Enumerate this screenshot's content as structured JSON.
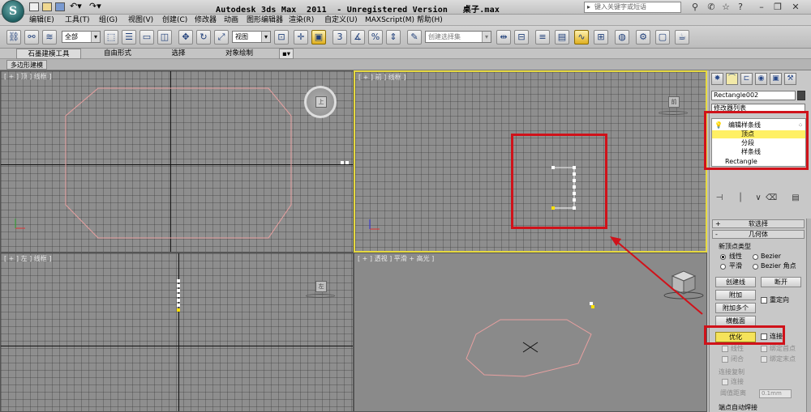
{
  "titlebar": {
    "logo": "S",
    "title": "Autodesk 3ds Max  2011  - Unregistered Version   桌子.max",
    "search_placeholder": "键入关键字或短语"
  },
  "menu": [
    "编辑(E)",
    "工具(T)",
    "组(G)",
    "视图(V)",
    "创建(C)",
    "修改器",
    "动画",
    "图形编辑器",
    "渲染(R)",
    "自定义(U)",
    "MAXScript(M)",
    "帮助(H)"
  ],
  "toolbar": {
    "filter_value": "全部",
    "refcoord_value": "视图",
    "selection_set_placeholder": "创建选择集"
  },
  "ribbon": {
    "tabs": [
      "石墨建模工具",
      "自由形式",
      "选择",
      "对象绘制"
    ],
    "subtab": "多边形建模"
  },
  "viewports": {
    "top": "[ + ] 顶 ] 线框 ]",
    "front": "[ + ] 前 ] 线框 ]",
    "left": "[ + ] 左 ] 线框 ]",
    "persp": "[ + ] 透视 ] 平滑 + 高光 ]",
    "top_cube": "上",
    "front_cube": "前",
    "left_cube": "左"
  },
  "command_panel": {
    "object_name": "Rectangle002",
    "modifier_list": "修改器列表",
    "stack": {
      "root": "编辑样条线",
      "vertex": "顶点",
      "segment": "分段",
      "spline": "样条线",
      "base": "Rectangle"
    },
    "rollouts": {
      "soft_selection": "软选择",
      "geometry": "几何体"
    },
    "new_vertex_type": {
      "title": "新顶点类型",
      "linear": "线性",
      "bezier": "Bezier",
      "smooth": "平滑",
      "bezier_corner": "Bezier 角点"
    },
    "buttons": {
      "create_line": "创建线",
      "break": "断开",
      "attach": "附加",
      "attach_multiple": "附加多个",
      "cross_section": "横截面",
      "refine": "优化",
      "connect": "连接",
      "reorient": "重定向"
    },
    "checks": {
      "linear": "线性",
      "bind_first": "绑定首点",
      "closed": "闭合",
      "bind_last": "绑定末点"
    },
    "connect_copy": {
      "title": "连接复制",
      "connect": "连接",
      "threshold_label": "阈值距离",
      "threshold_value": "0.1mm"
    },
    "endpoint_auto_weld": "端点自动焊接"
  }
}
